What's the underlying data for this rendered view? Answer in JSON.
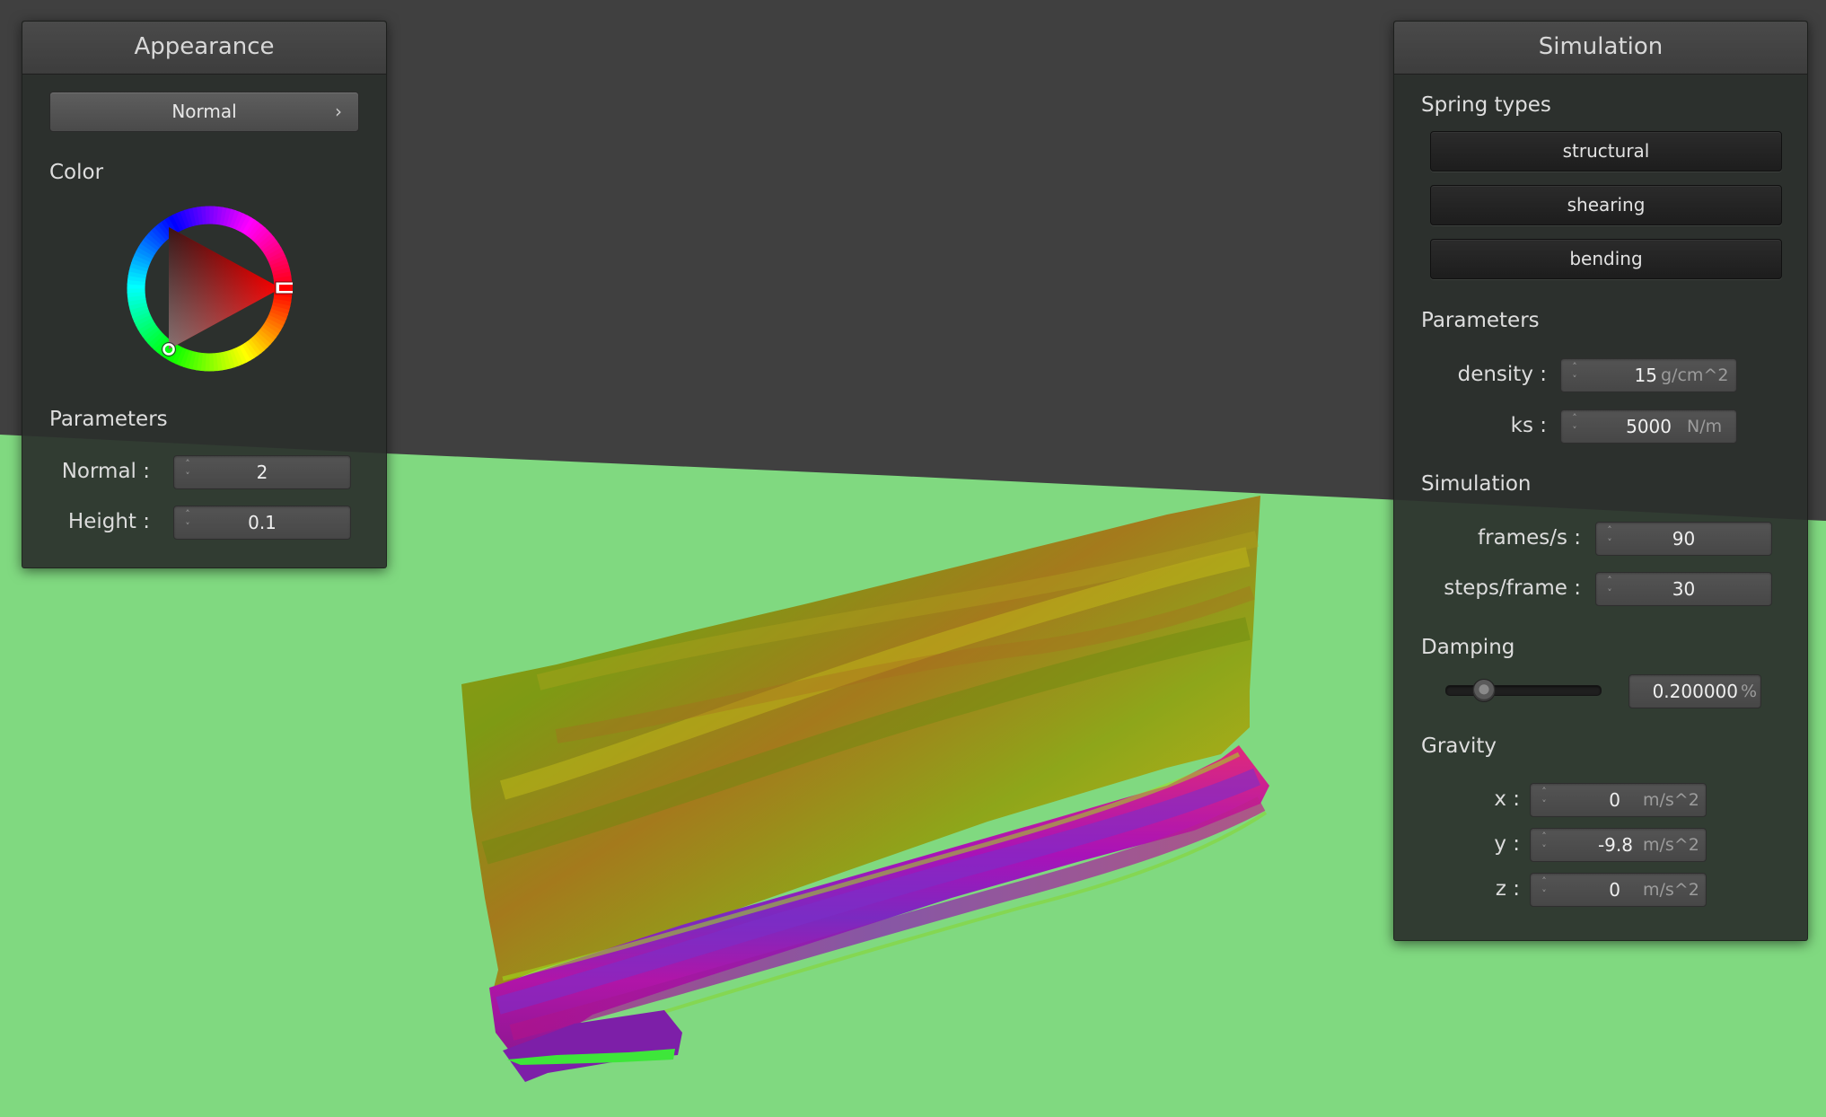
{
  "appearance": {
    "title": "Appearance",
    "mode_label": "Normal",
    "color_label": "Color",
    "color_value": "#ff0000",
    "parameters_label": "Parameters",
    "normal": {
      "label": "Normal :",
      "value": "2"
    },
    "height": {
      "label": "Height :",
      "value": "0.1"
    }
  },
  "simulation": {
    "title": "Simulation",
    "spring_types_label": "Spring types",
    "springs": [
      {
        "label": "structural"
      },
      {
        "label": "shearing"
      },
      {
        "label": "bending"
      }
    ],
    "parameters_label": "Parameters",
    "density": {
      "label": "density :",
      "value": "15",
      "unit": "g/cm^2"
    },
    "ks": {
      "label": "ks :",
      "value": "5000",
      "unit": "N/m"
    },
    "simulation_label": "Simulation",
    "fps": {
      "label": "frames/s :",
      "value": "90"
    },
    "steps": {
      "label": "steps/frame :",
      "value": "30"
    },
    "damping_label": "Damping",
    "damping": {
      "value": "0.200000",
      "unit": "%",
      "level": 0.2
    },
    "gravity_label": "Gravity",
    "gravity": {
      "x": {
        "label": "x :",
        "value": "0",
        "unit": "m/s^2"
      },
      "y": {
        "label": "y :",
        "value": "-9.8",
        "unit": "m/s^2"
      },
      "z": {
        "label": "z :",
        "value": "0",
        "unit": "m/s^2"
      }
    }
  },
  "scene": {
    "background_color": "#404040",
    "floor_color": "#80d980"
  }
}
